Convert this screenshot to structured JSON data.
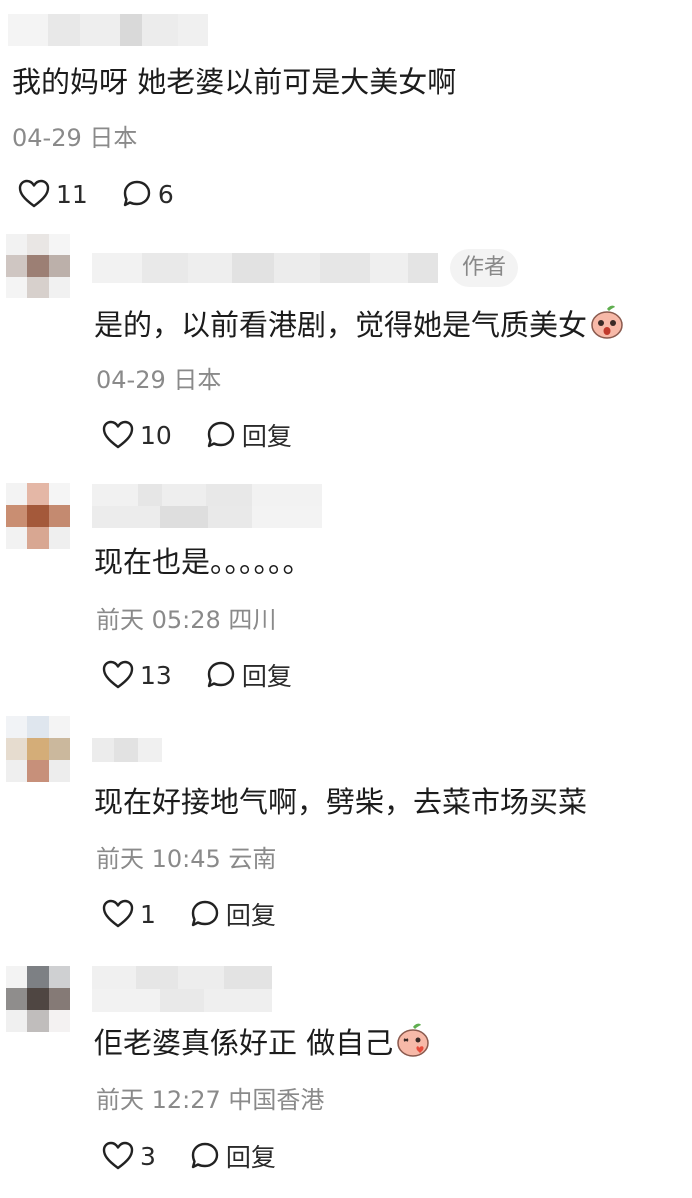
{
  "colors": {
    "text": "#1c1c1c",
    "meta": "#8a8a8a",
    "badge_bg": "#f3f3f3"
  },
  "top_comment": {
    "text": "我的妈呀 她老婆以前可是大美女啊",
    "meta": "04-29 日本",
    "likes": "11",
    "replies": "6",
    "icons": [
      "heart-icon",
      "comment-bubble-icon"
    ]
  },
  "replies": [
    {
      "text": "是的，以前看港剧，觉得她是气质美女",
      "emoji": "surprised-peach-emoji",
      "badge": "作者",
      "meta": "04-29 日本",
      "likes": "10",
      "reply_label": "回复"
    },
    {
      "text": "现在也是。。。。。。",
      "meta": "前天 05:28 四川",
      "likes": "13",
      "reply_label": "回复"
    },
    {
      "text": "现在好接地气啊，劈柴，去菜市场买菜",
      "meta": "前天 10:45 云南",
      "likes": "1",
      "reply_label": "回复"
    },
    {
      "text": "佢老婆真係好正 做自己",
      "emoji": "kiss-peach-emoji",
      "meta": "前天 12:27 中国香港",
      "likes": "3",
      "reply_label": "回复"
    }
  ]
}
